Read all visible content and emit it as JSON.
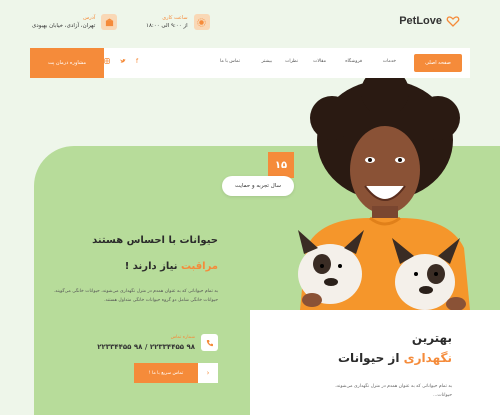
{
  "brand": {
    "name": "PetLove"
  },
  "header": {
    "hours": {
      "title": "ساعت کاری",
      "value": "از ۹:۰۰ الی ۱۸:۰۰"
    },
    "address": {
      "title": "آدرس",
      "value": "تهران، آزادی، خیابان بهبودی"
    }
  },
  "nav": {
    "home": "صفحه اصلی",
    "items": [
      "خدمات",
      "فروشگاه",
      "مقالات",
      "نظرات",
      "بیشتر",
      "تماس با ما"
    ],
    "cta": "مشاوره درمان پت"
  },
  "hero": {
    "badge_number": "۱۵",
    "badge_text": "سال تجربه و حمایت",
    "headline_1": "حیوانات با احساس هستند",
    "headline_2_accent": "مراقبت",
    "headline_2_rest": " نیاز دارند !",
    "description": "به تمام حیواناتی که به عنوان همدم در منزل نگهداری می‌شوند، حیوانات خانگی می‌گویند. حیوانات خانگی شامل دو گروه حیوانات خانگی متداول هستند.",
    "contact_label": "شماره تماس",
    "contact_number": "۹۸ ۲۲۳۳۴۴۵۵ / ۹۸ ۲۲۳۳۴۴۵۵",
    "cta": "تماس سریع با ما !"
  },
  "card": {
    "title_1": "بهترین",
    "title_2_accent": "نگهداری",
    "title_2_rest": " از حیوانات",
    "description": "به تمام حیواناتی که به عنوان همدم در منزل نگهداری می‌شوند، حیوانات..."
  },
  "colors": {
    "accent": "#f58b3a",
    "green": "#b7dc9a",
    "bg": "#eef6ea"
  }
}
